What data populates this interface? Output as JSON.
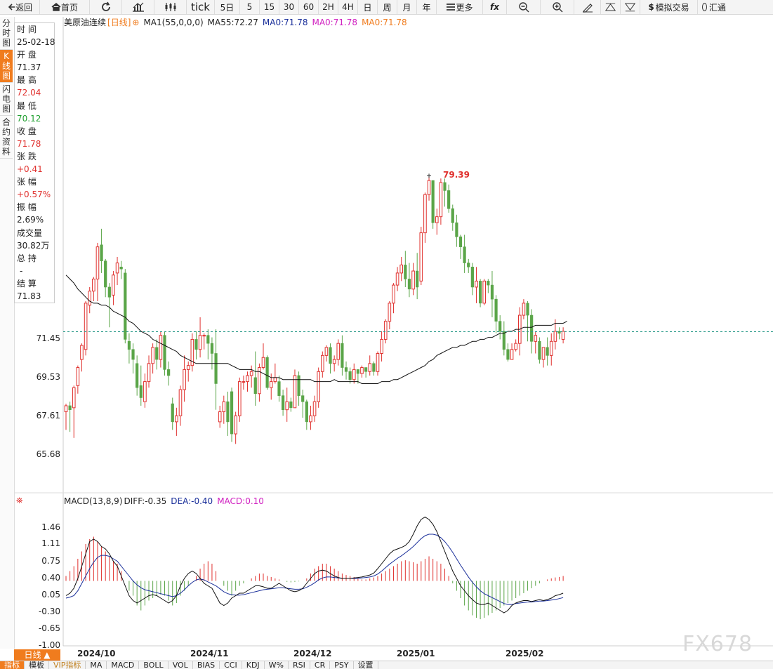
{
  "toolbar": {
    "back": "返回",
    "home": "首页",
    "tick": "tick",
    "periods": [
      "5日",
      "5",
      "15",
      "30",
      "60",
      "2H",
      "4H",
      "日",
      "周",
      "月",
      "年"
    ],
    "more": "更多",
    "fx": "fx",
    "sim_trade": "模拟交易",
    "huitong": "汇通"
  },
  "sidebar": {
    "tabs": [
      "分时图",
      "K线图",
      "闪电图",
      "合约资料"
    ]
  },
  "info": {
    "time_label": "时 间",
    "time_value": "25-02-18",
    "open_label": "开 盘",
    "open_value": "71.37",
    "high_label": "最 高",
    "high_value": "72.04",
    "low_label": "最 低",
    "low_value": "70.12",
    "close_label": "收 盘",
    "close_value": "71.78",
    "change_label": "张 跌",
    "change_value": "+0.41",
    "pct_label": "张 幅",
    "pct_value": "+0.57%",
    "amp_label": "振 幅",
    "amp_value": "2.69%",
    "vol_label": "成交量",
    "vol_value": "30.82万",
    "oi_label": "总 持",
    "oi_value": "-",
    "settle_label": "结 算",
    "settle_value": "71.83"
  },
  "legend": {
    "title": "美原油连续",
    "period": "[日线]",
    "ma1": "MA1(55,0,0,0)",
    "ma55": "MA55:72.27",
    "ma0a": "MA0:71.78",
    "ma0b": "MA0:71.78",
    "ma0c": "MA0:71.78"
  },
  "macd_legend": {
    "name": "MACD(13,8,9)",
    "diff": "DIFF:-0.35",
    "dea": "DEA:-0.40",
    "macd": "MACD:0.10"
  },
  "high_label": "79.39",
  "bottom": {
    "period_button": "日线 ▲",
    "tabs": [
      "指标",
      "模板",
      "VIP指标",
      "MA",
      "MACD",
      "BOLL",
      "VOL",
      "BIAS",
      "CCI",
      "KDJ",
      "W%",
      "RSI",
      "CR",
      "PSY",
      "设置"
    ]
  },
  "watermark": "FX678",
  "colors": {
    "up": "#e0312e",
    "down": "#5aa548",
    "diff": "#111111",
    "dea": "#1a2f9a",
    "ma55": "#111111",
    "lastprice": "#2a9a8a"
  },
  "chart_data": {
    "type": "candlestick",
    "price_ticks": [
      "71.45",
      "69.53",
      "67.61",
      "65.68"
    ],
    "price_tick_values": [
      71.45,
      69.53,
      67.61,
      65.68
    ],
    "macd_ticks": [
      "1.46",
      "1.11",
      "0.75",
      "0.40",
      "0.05",
      "-0.30",
      "-0.65",
      "-1.00"
    ],
    "macd_tick_values": [
      1.46,
      1.11,
      0.75,
      0.4,
      0.05,
      -0.3,
      -0.65,
      -1.0
    ],
    "x_labels": [
      "2024/10",
      "2024/11",
      "2024/12",
      "2025/01",
      "2025/02"
    ],
    "last_price": 71.78,
    "candles": [
      [
        67.8,
        68.1,
        66.9,
        68.2
      ],
      [
        68.1,
        67.9,
        66.8,
        68.3
      ],
      [
        68.0,
        69.0,
        66.5,
        69.1
      ],
      [
        69.1,
        70.0,
        68.7,
        70.1
      ],
      [
        70.4,
        71.1,
        69.8,
        71.2
      ],
      [
        70.9,
        73.2,
        70.6,
        73.3
      ],
      [
        73.1,
        73.8,
        72.7,
        74.0
      ],
      [
        73.8,
        74.4,
        73.3,
        74.5
      ],
      [
        74.4,
        76.0,
        73.3,
        76.2
      ],
      [
        76.1,
        75.3,
        74.7,
        76.9
      ],
      [
        75.3,
        74.0,
        73.5,
        75.4
      ],
      [
        74.0,
        73.5,
        72.0,
        74.2
      ],
      [
        73.6,
        74.6,
        73.1,
        74.8
      ],
      [
        74.7,
        75.2,
        74.1,
        75.5
      ],
      [
        75.0,
        74.9,
        74.4,
        75.3
      ],
      [
        74.7,
        71.4,
        71.2,
        74.9
      ],
      [
        71.3,
        70.9,
        70.2,
        71.7
      ],
      [
        70.9,
        70.4,
        69.7,
        71.2
      ],
      [
        70.2,
        69.0,
        68.6,
        70.6
      ],
      [
        69.1,
        68.5,
        68.1,
        70.1
      ],
      [
        68.3,
        69.3,
        68.0,
        69.7
      ],
      [
        69.3,
        70.2,
        69.0,
        70.6
      ],
      [
        70.2,
        71.0,
        69.7,
        71.2
      ],
      [
        71.0,
        70.4,
        69.9,
        71.4
      ],
      [
        70.4,
        71.6,
        70.0,
        71.8
      ],
      [
        71.6,
        69.9,
        69.6,
        71.8
      ],
      [
        69.9,
        69.6,
        69.1,
        70.3
      ],
      [
        68.2,
        67.3,
        66.9,
        68.5
      ],
      [
        67.3,
        67.6,
        66.6,
        68.0
      ],
      [
        67.6,
        68.9,
        67.1,
        69.1
      ],
      [
        68.9,
        69.9,
        68.3,
        70.6
      ],
      [
        69.9,
        70.1,
        69.3,
        70.3
      ],
      [
        70.1,
        71.4,
        69.8,
        71.7
      ],
      [
        71.4,
        70.9,
        70.4,
        71.8
      ],
      [
        70.9,
        71.6,
        70.5,
        72.5
      ],
      [
        71.6,
        71.6,
        70.9,
        71.7
      ],
      [
        71.6,
        71.2,
        70.4,
        71.9
      ],
      [
        71.2,
        70.7,
        69.9,
        71.5
      ],
      [
        70.7,
        69.2,
        67.9,
        71.9
      ],
      [
        67.3,
        67.8,
        67.0,
        68.1
      ],
      [
        67.8,
        68.3,
        67.2,
        68.6
      ],
      [
        68.3,
        67.3,
        66.6,
        68.8
      ],
      [
        68.8,
        66.7,
        66.3,
        69.0
      ],
      [
        66.7,
        67.6,
        66.2,
        67.8
      ],
      [
        67.6,
        69.3,
        67.3,
        69.5
      ],
      [
        69.3,
        69.3,
        68.9,
        69.6
      ],
      [
        69.3,
        69.6,
        68.8,
        69.8
      ],
      [
        69.6,
        69.8,
        69.0,
        70.1
      ],
      [
        69.5,
        68.7,
        68.1,
        70.8
      ],
      [
        68.7,
        70.0,
        68.3,
        70.2
      ],
      [
        70.0,
        70.5,
        69.9,
        71.2
      ],
      [
        70.5,
        69.0,
        68.9,
        70.6
      ],
      [
        69.0,
        69.3,
        68.4,
        69.7
      ],
      [
        69.3,
        69.5,
        69.2,
        70.2
      ],
      [
        69.3,
        68.6,
        68.3,
        69.6
      ],
      [
        68.6,
        67.9,
        67.6,
        68.9
      ],
      [
        67.9,
        68.3,
        67.3,
        69.0
      ],
      [
        68.3,
        68.0,
        67.8,
        68.5
      ],
      [
        68.0,
        69.6,
        68.0,
        69.9
      ],
      [
        69.6,
        68.6,
        68.1,
        69.8
      ],
      [
        68.6,
        68.3,
        67.5,
        68.9
      ],
      [
        68.3,
        67.3,
        66.9,
        68.4
      ],
      [
        67.3,
        67.6,
        66.9,
        68.1
      ],
      [
        67.6,
        68.3,
        67.3,
        68.6
      ],
      [
        68.3,
        69.8,
        68.0,
        70.0
      ],
      [
        69.8,
        70.6,
        69.5,
        70.8
      ],
      [
        70.6,
        71.0,
        70.3,
        71.1
      ],
      [
        71.0,
        70.2,
        69.7,
        71.2
      ],
      [
        70.2,
        70.4,
        69.8,
        70.6
      ],
      [
        70.4,
        71.2,
        70.1,
        71.4
      ],
      [
        71.2,
        70.0,
        69.6,
        71.6
      ],
      [
        70.0,
        69.8,
        69.4,
        70.3
      ],
      [
        69.8,
        69.4,
        69.2,
        70.0
      ],
      [
        69.4,
        69.9,
        69.2,
        70.2
      ],
      [
        69.9,
        69.7,
        69.2,
        69.9
      ],
      [
        69.7,
        70.0,
        69.5,
        70.1
      ],
      [
        70.0,
        69.8,
        69.5,
        70.0
      ],
      [
        69.8,
        70.2,
        69.6,
        70.6
      ],
      [
        70.2,
        69.8,
        69.6,
        70.3
      ],
      [
        69.8,
        70.7,
        69.6,
        70.8
      ],
      [
        70.7,
        71.4,
        70.3,
        71.8
      ],
      [
        71.4,
        72.3,
        71.2,
        72.4
      ],
      [
        72.3,
        73.2,
        71.9,
        73.3
      ],
      [
        73.2,
        74.1,
        72.7,
        74.2
      ],
      [
        74.1,
        74.7,
        73.8,
        75.0
      ],
      [
        74.7,
        75.1,
        74.3,
        75.5
      ],
      [
        75.1,
        74.4,
        74.0,
        75.8
      ],
      [
        74.4,
        73.9,
        73.5,
        75.2
      ],
      [
        73.9,
        74.8,
        73.6,
        75.2
      ],
      [
        74.8,
        74.0,
        73.4,
        75.7
      ],
      [
        74.3,
        76.7,
        74.1,
        77.0
      ],
      [
        76.7,
        78.6,
        76.2,
        78.7
      ],
      [
        78.6,
        79.3,
        78.3,
        79.5
      ],
      [
        79.3,
        77.2,
        76.9,
        79.3
      ],
      [
        77.2,
        77.5,
        76.6,
        77.9
      ],
      [
        77.5,
        79.2,
        77.1,
        79.4
      ],
      [
        79.2,
        78.8,
        78.0,
        79.4
      ],
      [
        78.8,
        77.9,
        77.7,
        79.1
      ],
      [
        77.9,
        77.2,
        76.8,
        78.1
      ],
      [
        77.2,
        76.5,
        76.0,
        77.6
      ],
      [
        76.5,
        76.0,
        75.4,
        76.6
      ],
      [
        76.0,
        75.2,
        74.7,
        76.6
      ],
      [
        75.2,
        75.0,
        74.7,
        75.4
      ],
      [
        75.0,
        74.0,
        73.6,
        75.2
      ],
      [
        74.0,
        74.3,
        73.2,
        75.0
      ],
      [
        74.3,
        73.2,
        73.0,
        74.4
      ],
      [
        73.2,
        74.3,
        73.1,
        74.4
      ],
      [
        74.3,
        74.1,
        73.7,
        74.4
      ],
      [
        74.1,
        73.4,
        72.5,
        74.8
      ],
      [
        73.4,
        72.3,
        71.7,
        73.6
      ],
      [
        72.3,
        71.8,
        71.4,
        72.6
      ],
      [
        71.8,
        70.9,
        70.6,
        72.3
      ],
      [
        70.9,
        70.4,
        70.3,
        71.2
      ],
      [
        70.4,
        70.9,
        70.4,
        71.2
      ],
      [
        70.9,
        71.2,
        70.8,
        71.4
      ],
      [
        71.2,
        72.6,
        70.6,
        73.0
      ],
      [
        72.6,
        73.2,
        72.4,
        73.4
      ],
      [
        73.2,
        72.6,
        71.3,
        73.3
      ],
      [
        72.6,
        71.3,
        70.7,
        72.9
      ],
      [
        71.3,
        71.6,
        70.7,
        71.8
      ],
      [
        71.3,
        70.4,
        70.2,
        71.5
      ],
      [
        70.4,
        71.0,
        70.0,
        71.0
      ],
      [
        71.0,
        70.6,
        70.1,
        71.5
      ],
      [
        70.6,
        71.3,
        70.1,
        71.7
      ],
      [
        71.3,
        71.8,
        70.9,
        72.4
      ],
      [
        71.8,
        71.7,
        71.4,
        72.0
      ],
      [
        71.4,
        71.8,
        71.2,
        72.0
      ]
    ],
    "ma55": [
      74.6,
      74.4,
      74.2,
      73.9,
      73.7,
      73.5,
      73.3,
      73.2,
      73.2,
      73.1,
      73.1,
      73.0,
      72.8,
      72.7,
      72.6,
      72.5,
      72.3,
      72.2,
      72.0,
      71.8,
      71.7,
      71.6,
      71.4,
      71.3,
      71.2,
      71.1,
      71.0,
      70.9,
      70.8,
      70.6,
      70.5,
      70.4,
      70.3,
      70.2,
      70.2,
      70.2,
      70.2,
      70.2,
      70.2,
      70.2,
      70.2,
      70.2,
      70.1,
      70.0,
      69.9,
      69.9,
      69.9,
      69.9,
      69.8,
      69.8,
      69.7,
      69.6,
      69.5,
      69.5,
      69.5,
      69.4,
      69.4,
      69.4,
      69.4,
      69.4,
      69.4,
      69.4,
      69.4,
      69.3,
      69.3,
      69.3,
      69.3,
      69.3,
      69.4,
      69.3,
      69.3,
      69.3,
      69.3,
      69.3,
      69.3,
      69.2,
      69.2,
      69.2,
      69.2,
      69.2,
      69.3,
      69.3,
      69.3,
      69.4,
      69.4,
      69.5,
      69.6,
      69.7,
      69.8,
      69.9,
      70.0,
      70.1,
      70.3,
      70.4,
      70.6,
      70.7,
      70.8,
      70.9,
      71.0,
      71.0,
      71.1,
      71.1,
      71.2,
      71.3,
      71.3,
      71.4,
      71.4,
      71.5,
      71.5,
      71.6,
      71.7,
      71.7,
      71.8,
      71.8,
      71.9,
      71.9,
      72.0,
      72.0,
      72.0,
      72.1,
      72.1,
      72.1,
      72.1,
      72.1,
      72.2,
      72.2,
      72.2,
      72.3
    ],
    "macd_bars": [
      0.1,
      0.2,
      0.3,
      0.45,
      0.6,
      0.75,
      0.85,
      0.9,
      0.8,
      0.7,
      0.6,
      0.5,
      0.4,
      0.35,
      0.2,
      0.0,
      -0.2,
      -0.3,
      -0.5,
      -0.6,
      -0.5,
      -0.4,
      -0.35,
      -0.3,
      -0.28,
      -0.3,
      -0.4,
      -0.5,
      -0.45,
      -0.3,
      -0.2,
      -0.1,
      0.0,
      0.1,
      0.25,
      0.35,
      0.4,
      0.35,
      0.2,
      0.0,
      -0.1,
      -0.2,
      -0.3,
      -0.2,
      -0.1,
      -0.05,
      0.0,
      0.05,
      0.1,
      0.15,
      0.15,
      0.1,
      0.08,
      0.05,
      0.03,
      0.0,
      -0.02,
      -0.03,
      -0.02,
      -0.01,
      0.0,
      0.05,
      0.15,
      0.25,
      0.3,
      0.35,
      0.35,
      0.3,
      0.25,
      0.2,
      0.15,
      0.12,
      0.1,
      0.08,
      0.05,
      0.03,
      0.03,
      0.05,
      0.07,
      0.1,
      0.15,
      0.2,
      0.25,
      0.3,
      0.35,
      0.4,
      0.42,
      0.4,
      0.38,
      0.35,
      0.4,
      0.45,
      0.5,
      0.45,
      0.4,
      0.35,
      0.25,
      0.1,
      -0.05,
      -0.2,
      -0.35,
      -0.5,
      -0.6,
      -0.7,
      -0.75,
      -0.78,
      -0.75,
      -0.7,
      -0.65,
      -0.6,
      -0.55,
      -0.5,
      -0.45,
      -0.4,
      -0.35,
      -0.3,
      -0.25,
      -0.2,
      -0.15,
      -0.1,
      -0.05,
      0.0,
      0.03,
      0.05,
      0.07,
      0.08,
      0.1
    ],
    "macd_diff": [
      -0.3,
      -0.25,
      -0.15,
      0.05,
      0.3,
      0.55,
      0.8,
      0.85,
      0.8,
      0.7,
      0.65,
      0.55,
      0.4,
      0.3,
      0.1,
      -0.1,
      -0.3,
      -0.4,
      -0.45,
      -0.4,
      -0.35,
      -0.3,
      -0.28,
      -0.3,
      -0.35,
      -0.4,
      -0.45,
      -0.4,
      -0.3,
      -0.1,
      0.05,
      0.15,
      0.2,
      0.15,
      0.05,
      -0.05,
      -0.1,
      -0.15,
      -0.3,
      -0.45,
      -0.5,
      -0.45,
      -0.35,
      -0.3,
      -0.25,
      -0.25,
      -0.2,
      -0.15,
      -0.1,
      -0.1,
      -0.12,
      -0.15,
      -0.15,
      -0.1,
      -0.05,
      -0.1,
      -0.15,
      -0.2,
      -0.22,
      -0.2,
      -0.15,
      -0.05,
      0.05,
      0.15,
      0.2,
      0.22,
      0.2,
      0.15,
      0.1,
      0.07,
      0.05,
      0.05,
      0.05,
      0.06,
      0.07,
      0.08,
      0.1,
      0.12,
      0.16,
      0.25,
      0.35,
      0.45,
      0.55,
      0.62,
      0.65,
      0.68,
      0.72,
      0.8,
      0.95,
      1.12,
      1.25,
      1.3,
      1.25,
      1.15,
      1.0,
      0.8,
      0.6,
      0.4,
      0.2,
      0.05,
      -0.1,
      -0.2,
      -0.3,
      -0.38,
      -0.45,
      -0.48,
      -0.48,
      -0.45,
      -0.5,
      -0.55,
      -0.6,
      -0.65,
      -0.6,
      -0.5,
      -0.45,
      -0.42,
      -0.4,
      -0.4,
      -0.42,
      -0.4,
      -0.38,
      -0.4,
      -0.38,
      -0.35,
      -0.3,
      -0.28,
      -0.25
    ],
    "macd_dea": [
      -0.35,
      -0.33,
      -0.3,
      -0.2,
      -0.05,
      0.1,
      0.25,
      0.38,
      0.48,
      0.52,
      0.52,
      0.5,
      0.45,
      0.4,
      0.3,
      0.2,
      0.1,
      0.0,
      -0.08,
      -0.14,
      -0.18,
      -0.2,
      -0.22,
      -0.24,
      -0.26,
      -0.28,
      -0.3,
      -0.32,
      -0.3,
      -0.25,
      -0.18,
      -0.1,
      -0.03,
      0.02,
      0.04,
      0.02,
      -0.02,
      -0.06,
      -0.1,
      -0.16,
      -0.22,
      -0.26,
      -0.28,
      -0.29,
      -0.29,
      -0.28,
      -0.26,
      -0.24,
      -0.22,
      -0.2,
      -0.18,
      -0.17,
      -0.16,
      -0.15,
      -0.14,
      -0.14,
      -0.15,
      -0.16,
      -0.17,
      -0.17,
      -0.16,
      -0.13,
      -0.09,
      -0.04,
      0.02,
      0.06,
      0.08,
      0.08,
      0.07,
      0.06,
      0.05,
      0.05,
      0.05,
      0.05,
      0.05,
      0.06,
      0.07,
      0.08,
      0.1,
      0.14,
      0.2,
      0.27,
      0.34,
      0.4,
      0.46,
      0.51,
      0.57,
      0.63,
      0.7,
      0.78,
      0.86,
      0.92,
      0.95,
      0.95,
      0.93,
      0.88,
      0.8,
      0.7,
      0.58,
      0.45,
      0.32,
      0.2,
      0.08,
      -0.03,
      -0.12,
      -0.2,
      -0.26,
      -0.3,
      -0.34,
      -0.38,
      -0.42,
      -0.46,
      -0.48,
      -0.48,
      -0.46,
      -0.45,
      -0.44,
      -0.43,
      -0.43,
      -0.42,
      -0.41,
      -0.41,
      -0.4,
      -0.39,
      -0.38,
      -0.36,
      -0.34
    ]
  }
}
